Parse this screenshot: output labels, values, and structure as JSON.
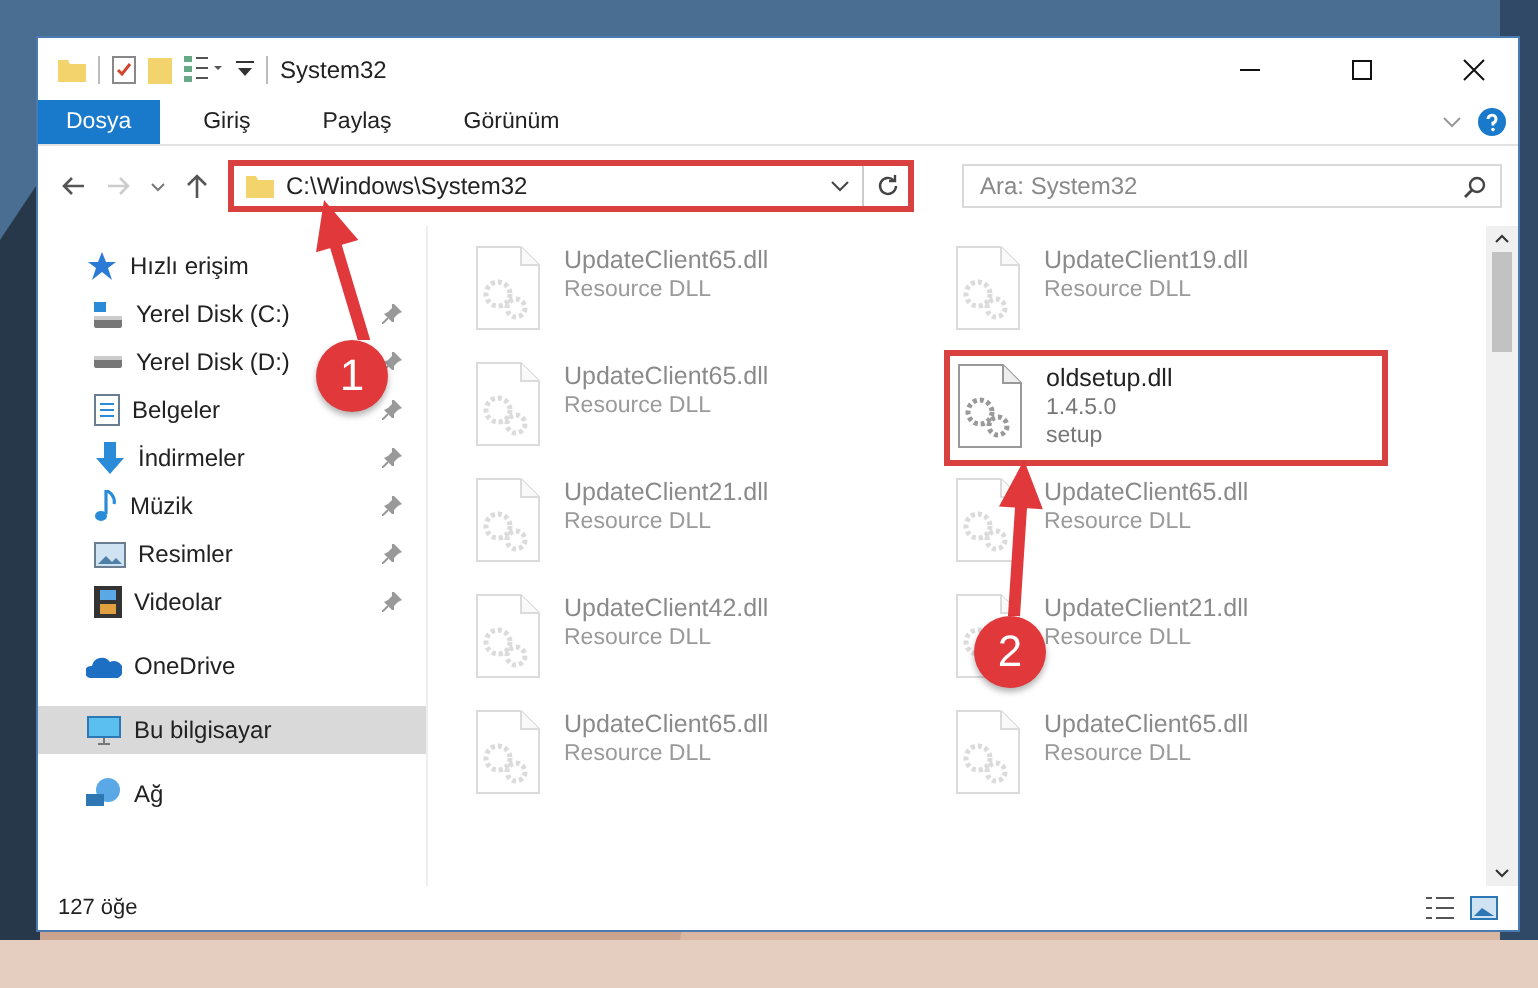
{
  "window": {
    "title": "System32"
  },
  "ribbon_tabs": [
    {
      "label": "Dosya",
      "selected": true
    },
    {
      "label": "Giriş",
      "selected": false
    },
    {
      "label": "Paylaş",
      "selected": false
    },
    {
      "label": "Görünüm",
      "selected": false
    }
  ],
  "address": {
    "path": "C:\\Windows\\System32",
    "highlighted": true
  },
  "search": {
    "placeholder": "Ara: System32"
  },
  "sidebar": {
    "items": [
      {
        "label": "Hızlı erişim",
        "kind": "star",
        "selected": false,
        "children": [
          {
            "label": "Yerel Disk (C:)",
            "kind": "drive-c",
            "selected": false,
            "pinned": true
          },
          {
            "label": "Yerel Disk (D:)",
            "kind": "drive",
            "selected": false,
            "pinned": true
          },
          {
            "label": "Belgeler",
            "kind": "docs",
            "selected": false,
            "pinned": true
          },
          {
            "label": "İndirmeler",
            "kind": "download",
            "selected": false,
            "pinned": true
          },
          {
            "label": "Müzik",
            "kind": "music",
            "selected": false,
            "pinned": true
          },
          {
            "label": "Resimler",
            "kind": "pictures",
            "selected": false,
            "pinned": true
          },
          {
            "label": "Videolar",
            "kind": "videos",
            "selected": false,
            "pinned": true
          }
        ]
      },
      {
        "label": "OneDrive",
        "kind": "cloud",
        "selected": false
      },
      {
        "label": "Bu bilgisayar",
        "kind": "pc",
        "selected": true
      },
      {
        "label": "Ağ",
        "kind": "network",
        "selected": false
      }
    ]
  },
  "files": [
    {
      "name": "UpdateClient65.dll",
      "lines": [
        "Resource DLL"
      ],
      "faded": true,
      "highlighted": false
    },
    {
      "name": "UpdateClient19.dll",
      "lines": [
        "Resource DLL"
      ],
      "faded": true,
      "highlighted": false
    },
    {
      "name": "UpdateClient65.dll",
      "lines": [
        "Resource DLL"
      ],
      "faded": true,
      "highlighted": false
    },
    {
      "name": "oldsetup.dll",
      "lines": [
        "1.4.5.0",
        "setup"
      ],
      "faded": false,
      "highlighted": true
    },
    {
      "name": "UpdateClient21.dll",
      "lines": [
        "Resource DLL"
      ],
      "faded": true,
      "highlighted": false
    },
    {
      "name": "UpdateClient65.dll",
      "lines": [
        "Resource DLL"
      ],
      "faded": true,
      "highlighted": false
    },
    {
      "name": "UpdateClient42.dll",
      "lines": [
        "Resource DLL"
      ],
      "faded": true,
      "highlighted": false
    },
    {
      "name": "UpdateClient21.dll",
      "lines": [
        "Resource DLL"
      ],
      "faded": true,
      "highlighted": false
    },
    {
      "name": "UpdateClient65.dll",
      "lines": [
        "Resource DLL"
      ],
      "faded": true,
      "highlighted": false
    },
    {
      "name": "UpdateClient65.dll",
      "lines": [
        "Resource DLL"
      ],
      "faded": true,
      "highlighted": false
    }
  ],
  "status_bar": {
    "count": "127 öğe"
  },
  "annotations": [
    {
      "number": "1"
    },
    {
      "number": "2"
    }
  ]
}
